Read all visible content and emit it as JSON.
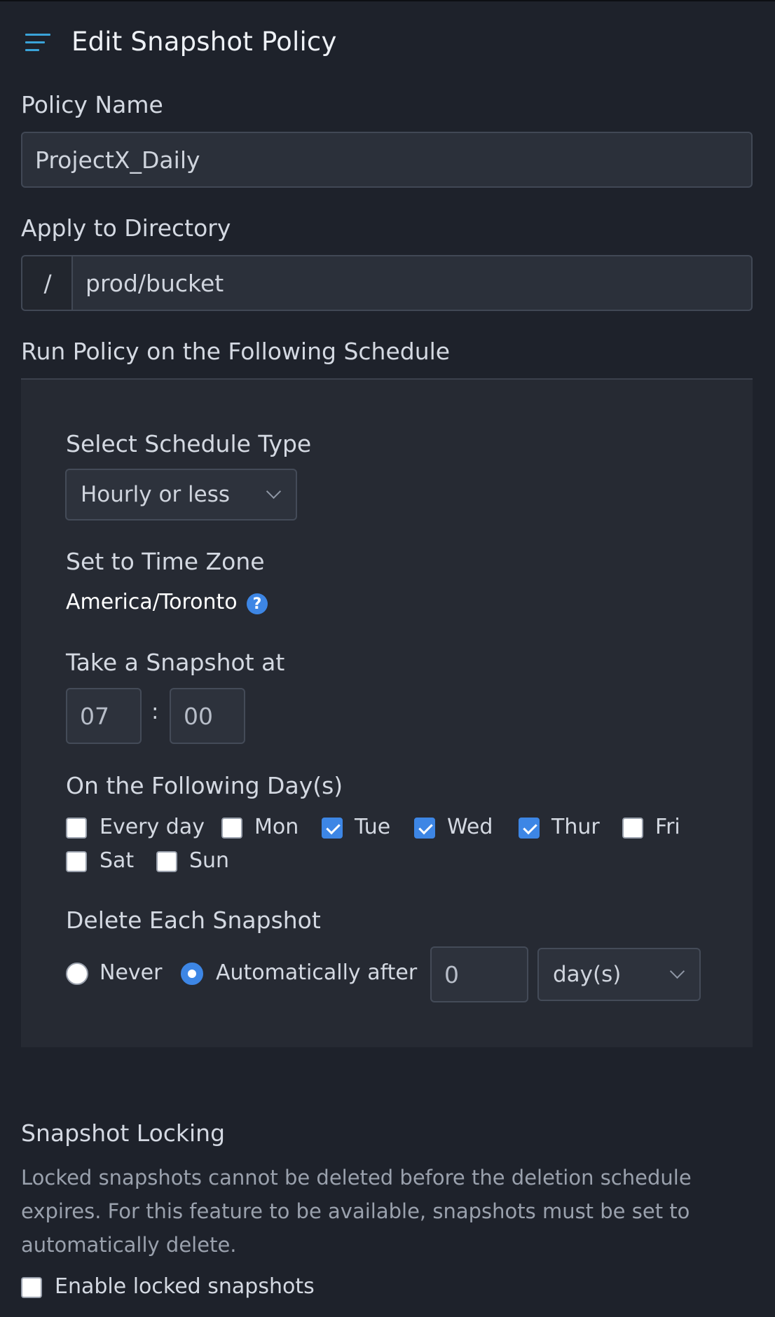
{
  "header": {
    "title": "Edit Snapshot Policy"
  },
  "policy_name": {
    "label": "Policy Name",
    "value": "ProjectX_Daily"
  },
  "directory": {
    "label": "Apply to Directory",
    "prefix": "/",
    "value": "prod/bucket"
  },
  "schedule": {
    "heading": "Run Policy on the Following Schedule",
    "type_label": "Select Schedule Type",
    "type_value": "Hourly or less",
    "timezone_label": "Set to Time Zone",
    "timezone_value": "America/Toronto",
    "snapshot_at_label": "Take a Snapshot at",
    "hour": "07",
    "separator": ":",
    "minute": "00",
    "days_label": "On the Following Day(s)",
    "days": [
      {
        "label": "Every day",
        "checked": false
      },
      {
        "label": "Mon",
        "checked": false
      },
      {
        "label": "Tue",
        "checked": true
      },
      {
        "label": "Wed",
        "checked": true
      },
      {
        "label": "Thur",
        "checked": true
      },
      {
        "label": "Fri",
        "checked": false
      },
      {
        "label": "Sat",
        "checked": false
      },
      {
        "label": "Sun",
        "checked": false
      }
    ],
    "delete_label": "Delete Each Snapshot",
    "delete_options": [
      {
        "label": "Never",
        "selected": false
      },
      {
        "label": "Automatically after",
        "selected": true
      }
    ],
    "delete_after_value": "0",
    "delete_unit": "day(s)"
  },
  "locking": {
    "heading": "Snapshot Locking",
    "description": "Locked snapshots cannot be deleted before the deletion schedule expires. For this feature to be available, snapshots must be set to automatically delete.",
    "checkbox_label": "Enable locked snapshots",
    "checkbox_checked": false
  },
  "colors": {
    "accent": "#3d86e5",
    "background": "#1e222b",
    "panel": "#262a33",
    "menu_icon": "#3aa3d8"
  }
}
